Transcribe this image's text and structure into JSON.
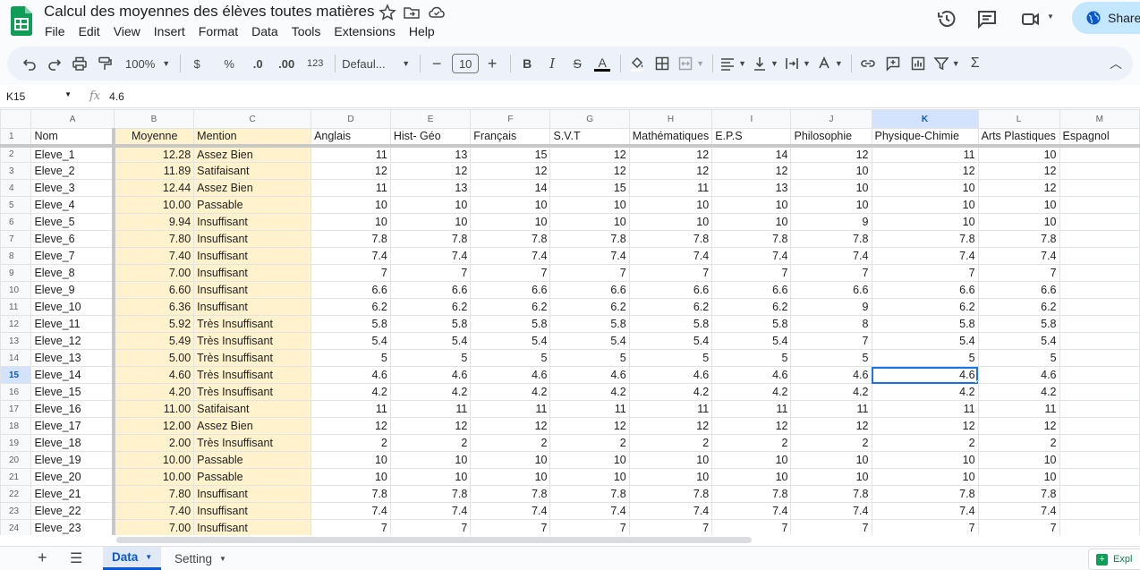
{
  "doc": {
    "title": "Calcul des moyennes des élèves toutes matières",
    "menu": [
      "File",
      "Edit",
      "View",
      "Insert",
      "Format",
      "Data",
      "Tools",
      "Extensions",
      "Help"
    ],
    "share_label": "Share"
  },
  "toolbar": {
    "zoom": "100%",
    "currency": "$",
    "percent": "%",
    "dec_decrease": ".0",
    "dec_increase": ".00",
    "number_format": "123",
    "font": "Defaul...",
    "font_size": "10"
  },
  "formula": {
    "cell_ref": "K15",
    "fx": "fx",
    "value": "4.6"
  },
  "columns": [
    "A",
    "B",
    "C",
    "D",
    "E",
    "F",
    "G",
    "H",
    "I",
    "J",
    "K",
    "L",
    "M"
  ],
  "header_row": [
    "Nom",
    "Moyenne",
    "Mention",
    "Anglais",
    "Hist- Géo",
    "Français",
    "S.V.T",
    "Mathématiques",
    "E.P.S",
    "Philosophie",
    "Physique-Chimie",
    "Arts Plastiques",
    "Espagnol"
  ],
  "rows": [
    {
      "n": "2",
      "cells": [
        "Eleve_1",
        "12.28",
        "Assez Bien",
        "11",
        "13",
        "15",
        "12",
        "12",
        "14",
        "12",
        "11",
        "10",
        ""
      ]
    },
    {
      "n": "3",
      "cells": [
        "Eleve_2",
        "11.89",
        "Satifaisant",
        "12",
        "12",
        "12",
        "12",
        "12",
        "12",
        "10",
        "12",
        "12",
        ""
      ]
    },
    {
      "n": "4",
      "cells": [
        "Eleve_3",
        "12.44",
        "Assez Bien",
        "11",
        "13",
        "14",
        "15",
        "11",
        "13",
        "10",
        "10",
        "12",
        ""
      ]
    },
    {
      "n": "5",
      "cells": [
        "Eleve_4",
        "10.00",
        "Passable",
        "10",
        "10",
        "10",
        "10",
        "10",
        "10",
        "10",
        "10",
        "10",
        ""
      ]
    },
    {
      "n": "6",
      "cells": [
        "Eleve_5",
        "9.94",
        "Insuffisant",
        "10",
        "10",
        "10",
        "10",
        "10",
        "10",
        "9",
        "10",
        "10",
        ""
      ]
    },
    {
      "n": "7",
      "cells": [
        "Eleve_6",
        "7.80",
        "Insuffisant",
        "7.8",
        "7.8",
        "7.8",
        "7.8",
        "7.8",
        "7.8",
        "7.8",
        "7.8",
        "7.8",
        ""
      ]
    },
    {
      "n": "8",
      "cells": [
        "Eleve_7",
        "7.40",
        "Insuffisant",
        "7.4",
        "7.4",
        "7.4",
        "7.4",
        "7.4",
        "7.4",
        "7.4",
        "7.4",
        "7.4",
        ""
      ]
    },
    {
      "n": "9",
      "cells": [
        "Eleve_8",
        "7.00",
        "Insuffisant",
        "7",
        "7",
        "7",
        "7",
        "7",
        "7",
        "7",
        "7",
        "7",
        ""
      ]
    },
    {
      "n": "10",
      "cells": [
        "Eleve_9",
        "6.60",
        "Insuffisant",
        "6.6",
        "6.6",
        "6.6",
        "6.6",
        "6.6",
        "6.6",
        "6.6",
        "6.6",
        "6.6",
        ""
      ]
    },
    {
      "n": "11",
      "cells": [
        "Eleve_10",
        "6.36",
        "Insuffisant",
        "6.2",
        "6.2",
        "6.2",
        "6.2",
        "6.2",
        "6.2",
        "9",
        "6.2",
        "6.2",
        ""
      ]
    },
    {
      "n": "12",
      "cells": [
        "Eleve_11",
        "5.92",
        "Très Insuffisant",
        "5.8",
        "5.8",
        "5.8",
        "5.8",
        "5.8",
        "5.8",
        "8",
        "5.8",
        "5.8",
        ""
      ]
    },
    {
      "n": "13",
      "cells": [
        "Eleve_12",
        "5.49",
        "Très Insuffisant",
        "5.4",
        "5.4",
        "5.4",
        "5.4",
        "5.4",
        "5.4",
        "7",
        "5.4",
        "5.4",
        ""
      ]
    },
    {
      "n": "14",
      "cells": [
        "Eleve_13",
        "5.00",
        "Très Insuffisant",
        "5",
        "5",
        "5",
        "5",
        "5",
        "5",
        "5",
        "5",
        "5",
        ""
      ]
    },
    {
      "n": "15",
      "cells": [
        "Eleve_14",
        "4.60",
        "Très Insuffisant",
        "4.6",
        "4.6",
        "4.6",
        "4.6",
        "4.6",
        "4.6",
        "4.6",
        "4.6",
        "4.6",
        ""
      ]
    },
    {
      "n": "16",
      "cells": [
        "Eleve_15",
        "4.20",
        "Très Insuffisant",
        "4.2",
        "4.2",
        "4.2",
        "4.2",
        "4.2",
        "4.2",
        "4.2",
        "4.2",
        "4.2",
        ""
      ]
    },
    {
      "n": "17",
      "cells": [
        "Eleve_16",
        "11.00",
        "Satifaisant",
        "11",
        "11",
        "11",
        "11",
        "11",
        "11",
        "11",
        "11",
        "11",
        ""
      ]
    },
    {
      "n": "18",
      "cells": [
        "Eleve_17",
        "12.00",
        "Assez Bien",
        "12",
        "12",
        "12",
        "12",
        "12",
        "12",
        "12",
        "12",
        "12",
        ""
      ]
    },
    {
      "n": "19",
      "cells": [
        "Eleve_18",
        "2.00",
        "Très Insuffisant",
        "2",
        "2",
        "2",
        "2",
        "2",
        "2",
        "2",
        "2",
        "2",
        ""
      ]
    },
    {
      "n": "20",
      "cells": [
        "Eleve_19",
        "10.00",
        "Passable",
        "10",
        "10",
        "10",
        "10",
        "10",
        "10",
        "10",
        "10",
        "10",
        ""
      ]
    },
    {
      "n": "21",
      "cells": [
        "Eleve_20",
        "10.00",
        "Passable",
        "10",
        "10",
        "10",
        "10",
        "10",
        "10",
        "10",
        "10",
        "10",
        ""
      ]
    },
    {
      "n": "22",
      "cells": [
        "Eleve_21",
        "7.80",
        "Insuffisant",
        "7.8",
        "7.8",
        "7.8",
        "7.8",
        "7.8",
        "7.8",
        "7.8",
        "7.8",
        "7.8",
        ""
      ]
    },
    {
      "n": "23",
      "cells": [
        "Eleve_22",
        "7.40",
        "Insuffisant",
        "7.4",
        "7.4",
        "7.4",
        "7.4",
        "7.4",
        "7.4",
        "7.4",
        "7.4",
        "7.4",
        ""
      ]
    },
    {
      "n": "24",
      "cells": [
        "Eleve_23",
        "7.00",
        "Insuffisant",
        "7",
        "7",
        "7",
        "7",
        "7",
        "7",
        "7",
        "7",
        "7",
        ""
      ]
    }
  ],
  "active_cell": {
    "row": "15",
    "col": "K"
  },
  "sheets": [
    {
      "name": "Data",
      "active": true
    },
    {
      "name": "Setting",
      "active": false
    }
  ],
  "explore_label": "Expl",
  "colors": {
    "accent": "#0b57d0",
    "highlight": "#fff2cc",
    "logo": "#0f9d58"
  }
}
